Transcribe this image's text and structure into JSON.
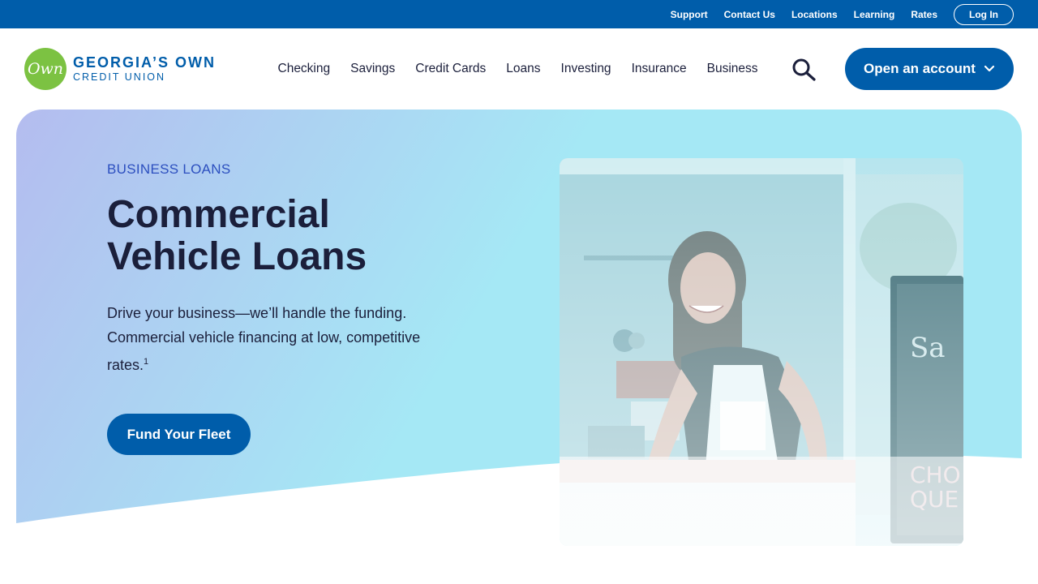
{
  "utility": {
    "links": [
      "Support",
      "Contact Us",
      "Locations",
      "Learning",
      "Rates"
    ],
    "login_label": "Log In"
  },
  "logo": {
    "badge_text": "Own",
    "line1": "GEORGIA’S OWN",
    "line2": "CREDIT UNION"
  },
  "nav": {
    "items": [
      "Checking",
      "Savings",
      "Credit Cards",
      "Loans",
      "Investing",
      "Insurance",
      "Business"
    ]
  },
  "header": {
    "open_account_label": "Open an account",
    "search_icon": "search-icon",
    "chevron_icon": "chevron-down-icon"
  },
  "hero": {
    "eyebrow": "BUSINESS LOANS",
    "title_line1": "Commercial",
    "title_line2": "Vehicle Loans",
    "desc_line1": "Drive your business—we’ll handle the funding.",
    "desc_line2": "Commercial vehicle financing at low, competitive",
    "desc_line3": "rates.",
    "footnote": "1",
    "cta_label": "Fund Your Fleet"
  },
  "colors": {
    "brand_blue": "#005daa",
    "logo_green": "#7cc242",
    "eyebrow_blue": "#2c4fbf",
    "gradient_start": "#b4bcef",
    "gradient_end": "#a5e8f5"
  }
}
